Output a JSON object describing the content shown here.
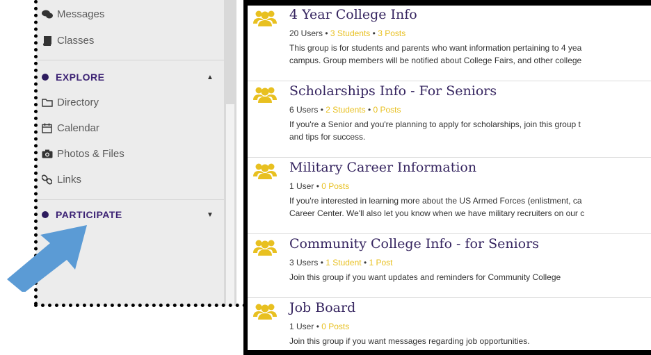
{
  "sidebar": {
    "items_top": [
      {
        "icon": "comments-icon",
        "label": "Messages"
      },
      {
        "icon": "book-icon",
        "label": "Classes"
      }
    ],
    "explore": {
      "title": "EXPLORE",
      "items": [
        {
          "icon": "folder-icon",
          "label": "Directory"
        },
        {
          "icon": "calendar-icon",
          "label": "Calendar"
        },
        {
          "icon": "camera-icon",
          "label": "Photos & Files"
        },
        {
          "icon": "link-icon",
          "label": "Links"
        }
      ]
    },
    "participate": {
      "title": "PARTICIPATE"
    }
  },
  "colors": {
    "accent": "#35245f",
    "highlight": "#e8c020",
    "arrow": "#5b9bd5"
  },
  "groups": [
    {
      "title": "4 Year College Info",
      "users": "20 Users",
      "students": "3 Students",
      "posts": "3 Posts",
      "desc1": "This group is for students and parents who want information pertaining to 4 yea",
      "desc2": "campus. Group members will be notified about College Fairs, and other college"
    },
    {
      "title": "Scholarships Info - For Seniors",
      "users": "6 Users",
      "students": "2 Students",
      "posts": "0 Posts",
      "desc1": "If you're a Senior and you're planning to apply for scholarships, join this group t",
      "desc2": "and tips for success."
    },
    {
      "title": "Military Career Information",
      "users": "1 User",
      "students": "",
      "posts": "0 Posts",
      "desc1": "If you're interested in learning more about the US Armed Forces (enlistment, ca",
      "desc2": "Career Center. We'll also let you know when we have military recruiters on our c"
    },
    {
      "title": "Community College Info - for Seniors",
      "users": "3 Users",
      "students": "1 Student",
      "posts": "1 Post",
      "desc1": "Join this group if you want updates and reminders for Community College",
      "desc2": ""
    },
    {
      "title": "Job Board",
      "users": "1 User",
      "students": "",
      "posts": "0 Posts",
      "desc1": "Join this group if you want messages regarding job opportunities.",
      "desc2": ""
    }
  ]
}
